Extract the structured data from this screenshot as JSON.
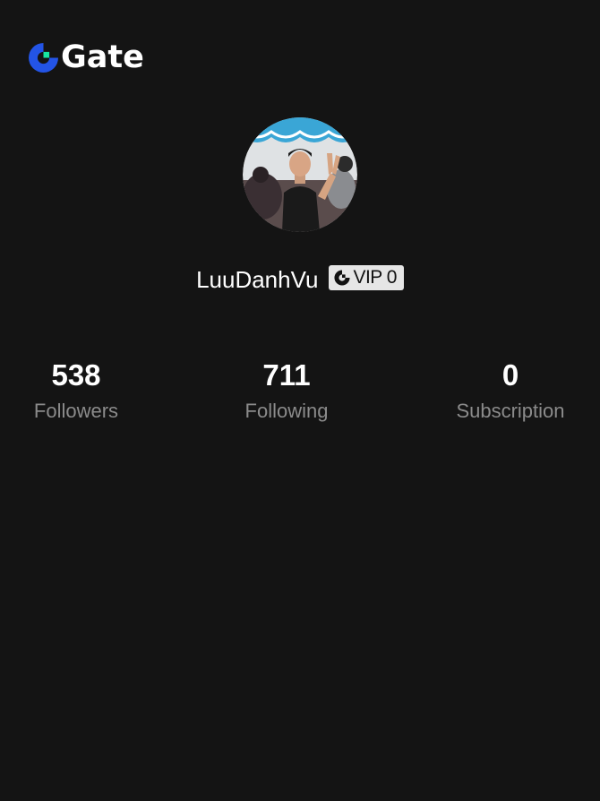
{
  "app": {
    "brand_name": "Gate",
    "brand_colors": {
      "logo_blue": "#2354e6",
      "logo_green": "#17e6a1"
    },
    "background": "#141414"
  },
  "profile": {
    "username": "LuuDanhVu",
    "vip_badge": {
      "label": "VIP 0",
      "icon": "gate-logo-icon"
    }
  },
  "stats": [
    {
      "value": "538",
      "label": "Followers"
    },
    {
      "value": "711",
      "label": "Following"
    },
    {
      "value": "0",
      "label": "Subscription"
    }
  ]
}
